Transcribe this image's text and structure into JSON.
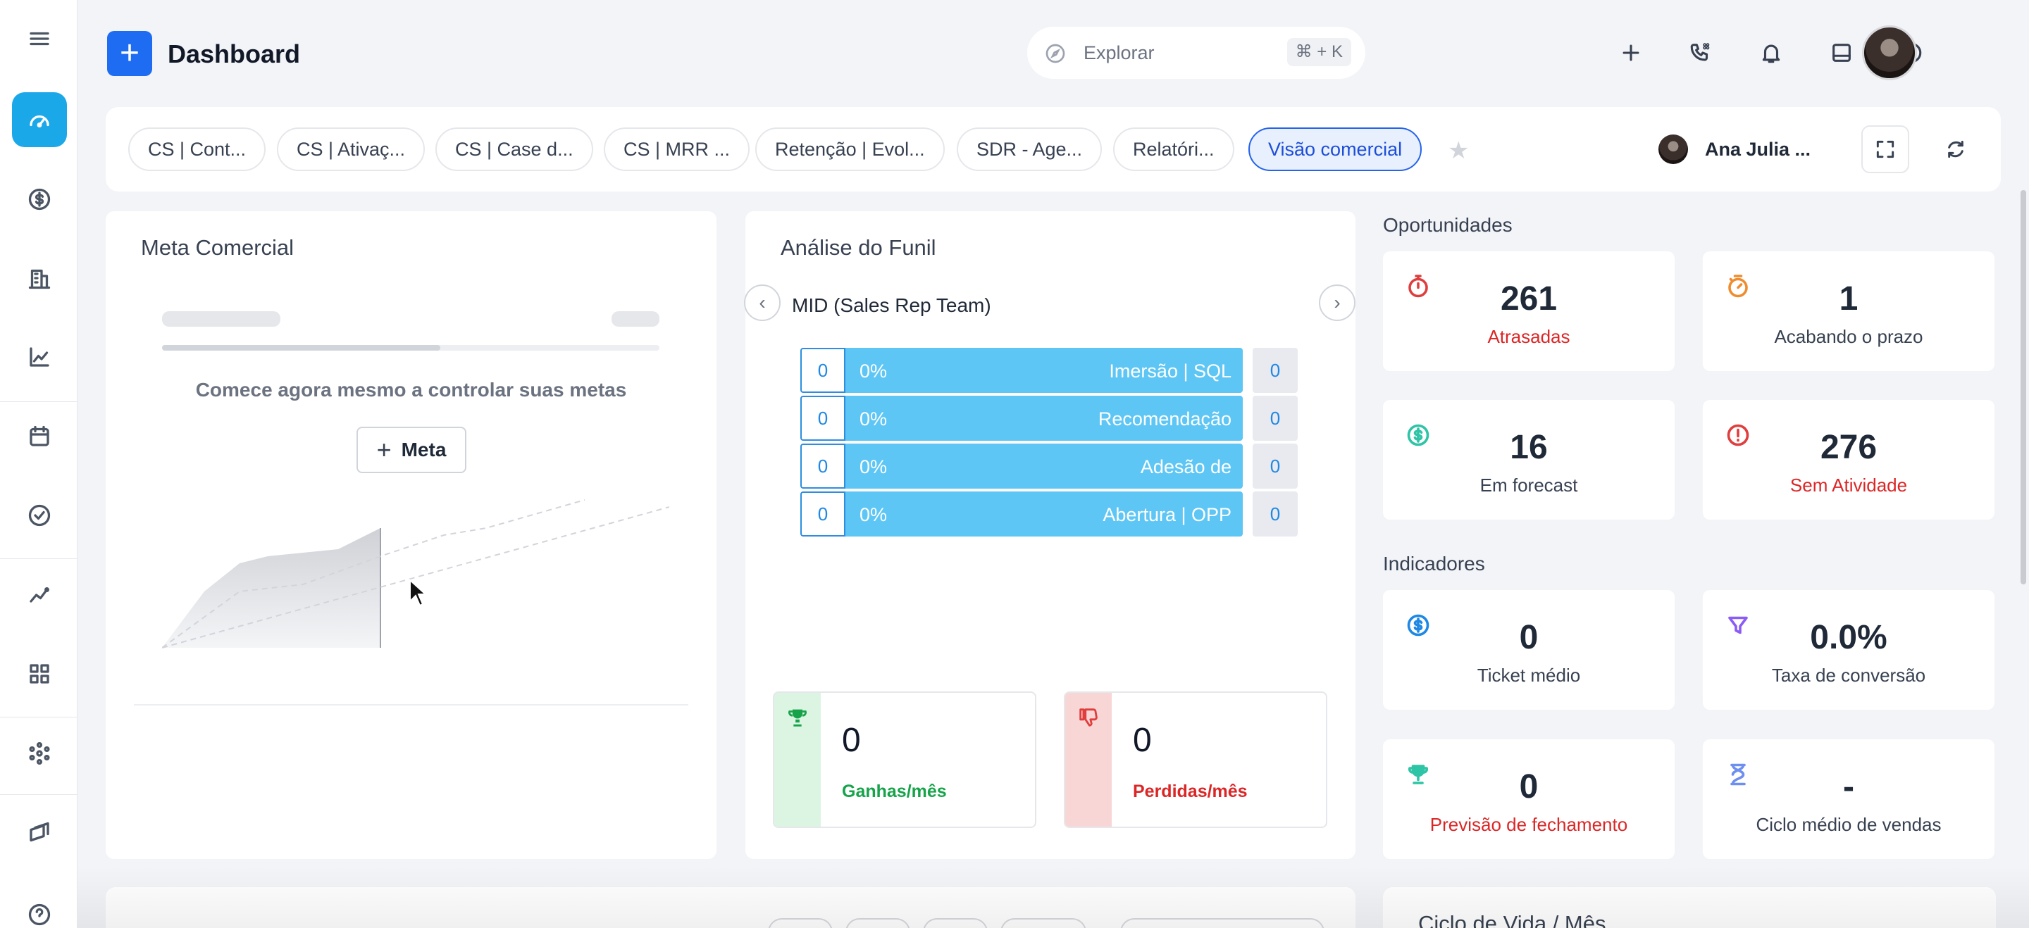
{
  "header": {
    "title": "Dashboard",
    "add_label": "+",
    "search": {
      "placeholder": "Explorar",
      "shortcut": "⌘ + K"
    },
    "icons": [
      "plus-icon",
      "phone-dialpad-icon",
      "bell-icon",
      "inbox-icon",
      "check-circle-icon"
    ]
  },
  "sidebar": {
    "items": [
      {
        "name": "menu-icon"
      },
      {
        "name": "dashboard-gauge-icon",
        "active": true
      },
      {
        "name": "dollar-icon"
      },
      {
        "name": "building-icon"
      },
      {
        "name": "chart-icon"
      },
      {
        "name": "calendar-icon"
      },
      {
        "name": "check-circle-icon"
      },
      {
        "name": "trend-icon"
      },
      {
        "name": "widgets-icon"
      },
      {
        "name": "network-icon"
      },
      {
        "name": "layers-icon"
      },
      {
        "name": "help-icon"
      }
    ]
  },
  "tabs": {
    "items": [
      "CS | Cont...",
      "CS | Ativaç...",
      "CS | Case d...",
      "CS | MRR ...",
      "Retenção | Evol...",
      "SDR - Age...",
      "Relatóri...",
      "Visão comercial"
    ],
    "active": "Visão comercial",
    "user": "Ana Julia ..."
  },
  "meta": {
    "title": "Meta Comercial",
    "message": "Comece agora mesmo a controlar suas metas",
    "button": "Meta"
  },
  "funil": {
    "title": "Análise do Funil",
    "team": "MID (Sales Rep Team)",
    "rows": [
      {
        "left": "0",
        "pct": "0%",
        "stage": "Imersão | SQL",
        "right": "0"
      },
      {
        "left": "0",
        "pct": "0%",
        "stage": "Recomendação",
        "right": "0"
      },
      {
        "left": "0",
        "pct": "0%",
        "stage": "Adesão de",
        "right": "0"
      },
      {
        "left": "0",
        "pct": "0%",
        "stage": "Abertura | OPP",
        "right": "0"
      }
    ],
    "won": {
      "value": "0",
      "label": "Ganhas/mês"
    },
    "lost": {
      "value": "0",
      "label": "Perdidas/mês"
    }
  },
  "oportunidades": {
    "title": "Oportunidades",
    "cards": [
      {
        "value": "261",
        "label": "Atrasadas",
        "red": true,
        "icon": "stopwatch-icon",
        "color": "#e03e3e"
      },
      {
        "value": "1",
        "label": "Acabando o prazo",
        "red": false,
        "icon": "timer-icon",
        "color": "#f08c2e"
      },
      {
        "value": "16",
        "label": "Em forecast",
        "red": false,
        "icon": "dollar-icon",
        "color": "#2ec4a6"
      },
      {
        "value": "276",
        "label": "Sem Atividade",
        "red": true,
        "icon": "alert-icon",
        "color": "#e03e3e"
      }
    ]
  },
  "indicadores": {
    "title": "Indicadores",
    "cards": [
      {
        "value": "0",
        "label": "Ticket médio",
        "red": false,
        "icon": "dollar-icon",
        "color": "#1e88e5"
      },
      {
        "value": "0.0%",
        "label": "Taxa de conversão",
        "red": false,
        "icon": "funnel-icon",
        "color": "#8b5cf6"
      },
      {
        "value": "0",
        "label": "Previsão de fechamento",
        "red": true,
        "icon": "trophy-icon",
        "color": "#2ec4a6"
      },
      {
        "value": "-",
        "label": "Ciclo médio de vendas",
        "red": false,
        "icon": "hourglass-icon",
        "color": "#6c8ff0"
      }
    ]
  },
  "bottom": {
    "title": "Ciclo de Vida / Mês"
  },
  "colors": {
    "accent": "#1e6cf2",
    "sidebar_active": "#1ba8e8",
    "funnel_bar": "#5ec6f5",
    "won": "#dcf5e2",
    "lost": "#f9d6d6"
  }
}
